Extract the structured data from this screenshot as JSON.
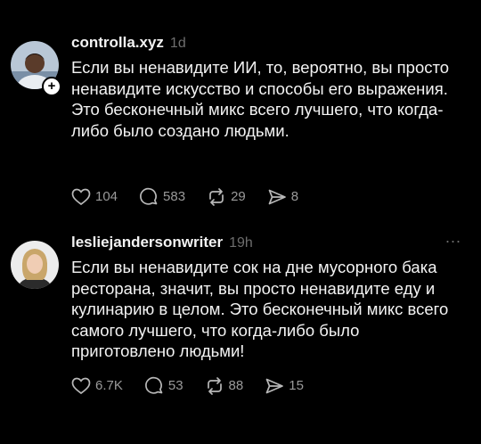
{
  "posts": [
    {
      "username": "controlla.xyz",
      "time": "1d",
      "avatar_icon": "person-photo-icon",
      "follow_badge": "+",
      "text": "Если вы ненавидите ИИ, то, вероятно, вы просто ненавидите искусство и способы его выражения. Это бесконечный микс всего лучшего, что когда-либо было создано людьми.",
      "likes": "104",
      "replies": "583",
      "reposts": "29",
      "shares": "8"
    },
    {
      "username": "lesliejandersonwriter",
      "time": "19h",
      "avatar_icon": "person-photo-icon",
      "more": "...",
      "text": "Если вы ненавидите сок на дне мусорного бака ресторана, значит, вы просто ненавидите еду и кулинарию в целом. Это бесконечный микс всего самого лучшего, что когда-либо было приготовлено людьми!",
      "likes": "6.7K",
      "replies": "53",
      "reposts": "88",
      "shares": "15"
    }
  ],
  "colors": {
    "background": "#000000",
    "text": "#f3f3f3",
    "muted": "#6e6e6e"
  },
  "icons": [
    "heart-icon",
    "comment-icon",
    "repost-icon",
    "share-icon"
  ]
}
